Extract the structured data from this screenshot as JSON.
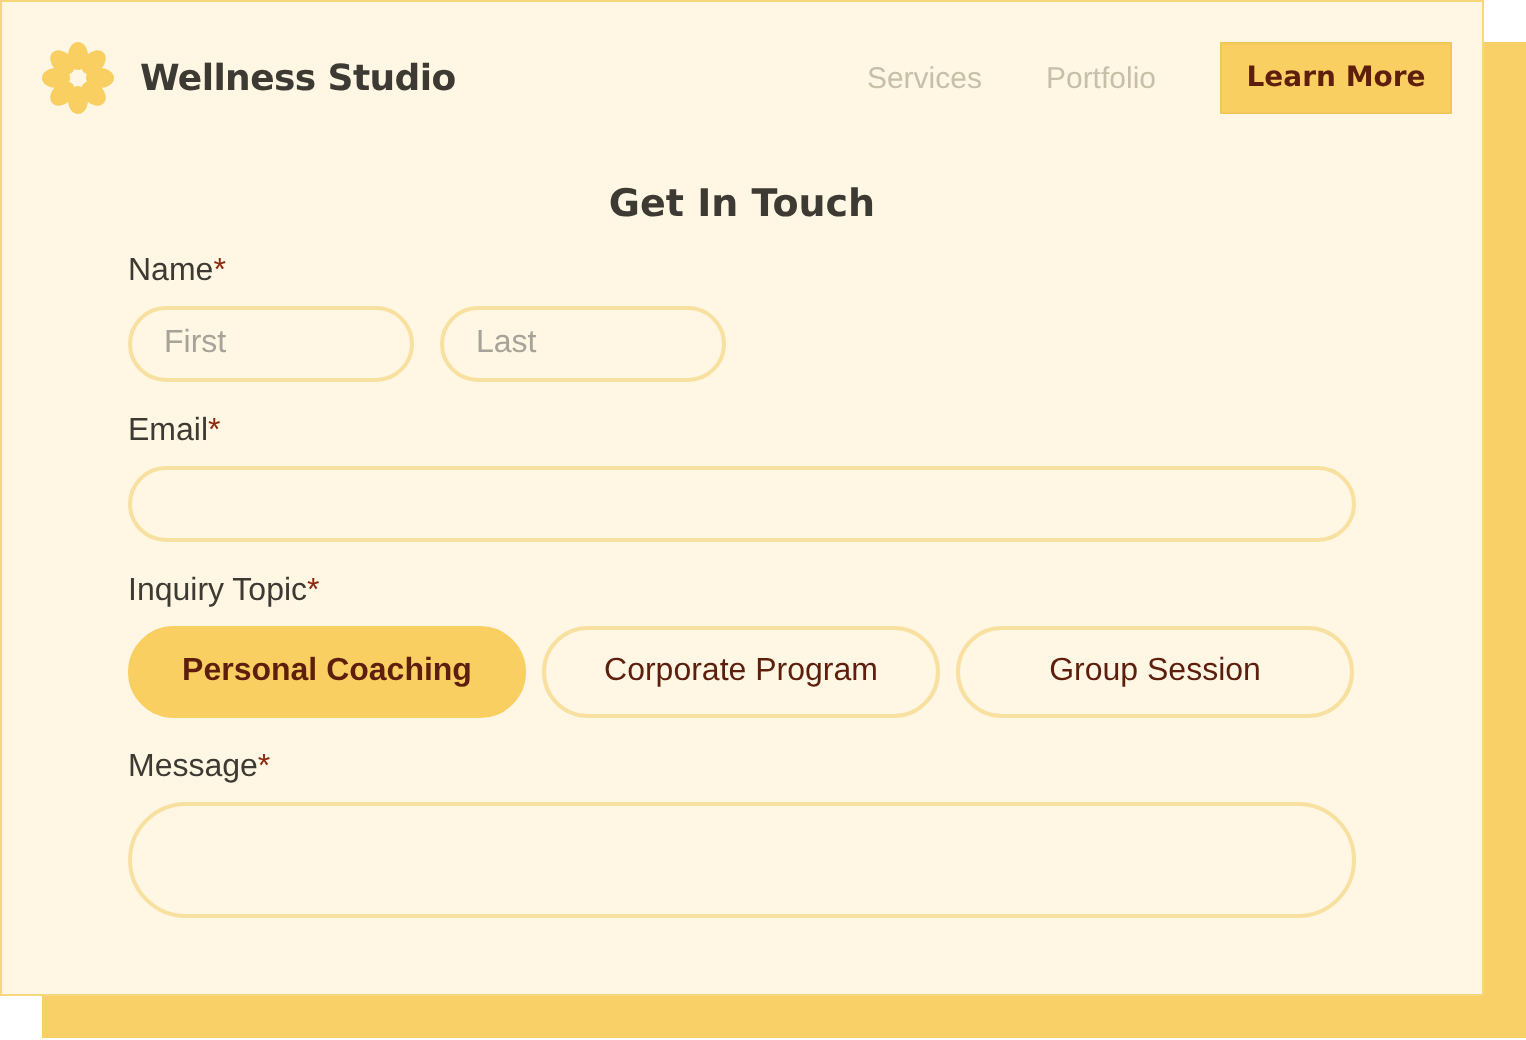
{
  "header": {
    "brand": "Wellness Studio",
    "nav": [
      {
        "label": "Services"
      },
      {
        "label": "Portfolio"
      }
    ],
    "cta": "Learn More"
  },
  "form": {
    "title": "Get In Touch",
    "name": {
      "label": "Name",
      "required_mark": "*",
      "first_placeholder": "First",
      "last_placeholder": "Last"
    },
    "email": {
      "label": "Email",
      "required_mark": "*"
    },
    "topic": {
      "label": "Inquiry Topic",
      "required_mark": "*",
      "options": [
        {
          "label": "Personal Coaching",
          "selected": true
        },
        {
          "label": "Corporate Program",
          "selected": false
        },
        {
          "label": "Group Session",
          "selected": false
        }
      ]
    },
    "message": {
      "label": "Message",
      "required_mark": "*"
    }
  }
}
